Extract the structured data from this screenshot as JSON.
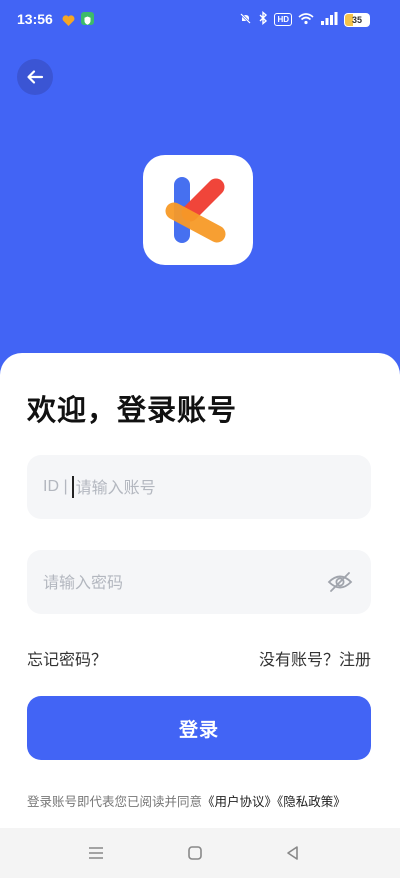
{
  "status_bar": {
    "time": "13:56",
    "icons": [
      "heart-icon",
      "shield-icon",
      "mute-icon",
      "bluetooth-icon",
      "hd-icon",
      "wifi-icon",
      "signal-icon",
      "battery-icon"
    ],
    "hd_label": "HD",
    "battery_level": "35"
  },
  "colors": {
    "brand": "#4264F5",
    "field_bg": "#F5F6F8",
    "logo_red": "#F0453A",
    "logo_blue": "#4670F0",
    "logo_orange": "#F79A28"
  },
  "header": {
    "back_icon": "arrow-left-icon",
    "logo_icon": "k-logo-icon"
  },
  "login": {
    "title": "欢迎，登录账号",
    "id_prefix": "ID |",
    "account_placeholder": "请输入账号",
    "password_placeholder": "请输入密码",
    "password_toggle_icon": "eye-off-icon",
    "forgot_password": "忘记密码？",
    "register": "没有账号？注册",
    "submit_label": "登录",
    "agreement_text": "登录账号即代表您已阅读并同意",
    "user_agreement": "《用户协议》",
    "privacy_policy": "《隐私政策》"
  },
  "nav_bar": {
    "buttons": [
      "menu-icon",
      "home-icon",
      "back-icon"
    ]
  }
}
